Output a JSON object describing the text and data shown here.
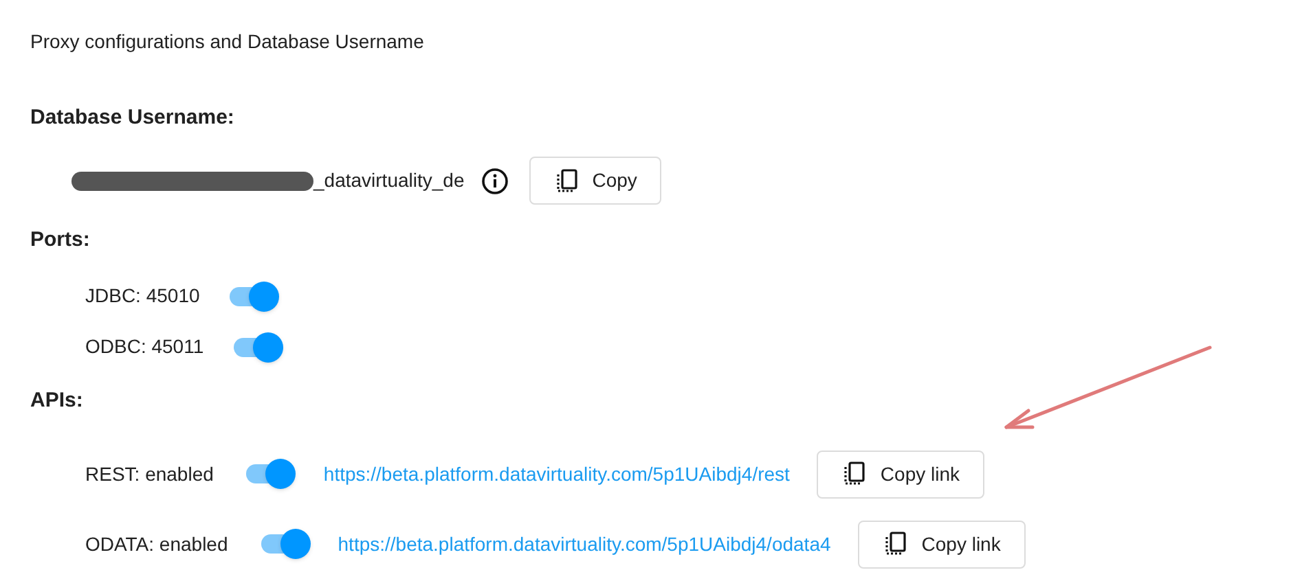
{
  "title": "Proxy configurations and Database Username",
  "database_username": {
    "heading": "Database Username:",
    "value": "_datavirtuality_de",
    "copy_button": "Copy"
  },
  "ports": {
    "heading": "Ports:",
    "items": [
      {
        "label": "JDBC: 45010",
        "on": true
      },
      {
        "label": "ODBC: 45011",
        "on": true
      }
    ]
  },
  "apis": {
    "heading": "APIs:",
    "items": [
      {
        "label": "REST: enabled",
        "on": true,
        "url": "https://beta.platform.datavirtuality.com/5p1UAibdj4/rest",
        "copy_button": "Copy link"
      },
      {
        "label": "ODATA: enabled",
        "on": true,
        "url": "https://beta.platform.datavirtuality.com/5p1UAibdj4/odata4",
        "copy_button": "Copy link"
      }
    ]
  }
}
